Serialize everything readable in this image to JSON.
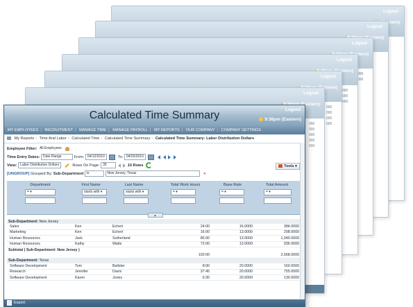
{
  "ghosts": [
    {
      "logout": "Logout",
      "time": "9:36pm (Eastern)",
      "col": []
    },
    {
      "logout": "Logout",
      "time": "9:36pm (Eastern)",
      "col": []
    },
    {
      "logout": "Logout",
      "time": "9:36pm (Eastern)",
      "col": [
        "000",
        "000"
      ]
    },
    {
      "logout": "Logout",
      "time": "9:36pm (Eastern)",
      "col": [
        "000",
        "000",
        "000"
      ]
    },
    {
      "logout": "Logout",
      "time": "9:36pm (Eastern)",
      "col": [
        "000",
        "000",
        "000",
        "000"
      ]
    },
    {
      "logout": "Logout",
      "time": "9:36pm (Eastern)",
      "col": [
        "000",
        "000",
        "000",
        "000",
        "000"
      ]
    }
  ],
  "header": {
    "title": "Calculated Time Summary",
    "logout": "Logout",
    "time": "9:36pm (Eastern)"
  },
  "nav": [
    "MY EMPLOYEES",
    "RECRUITMENT",
    "MANAGE TIME",
    "MANAGE PAYROLL",
    "MY REPORTS",
    "OUR COMPANY",
    "COMPANY SETTINGS"
  ],
  "breadcrumb": {
    "items": [
      "My Reports",
      "Time And Labor",
      "Calculated Time",
      "Calculated Time Summary"
    ],
    "current": "Calculated Time Summary: Labor Distribution Dollars"
  },
  "filters": {
    "employee_label": "Employee Filter:",
    "employee_value": "All Employees",
    "dates_label": "Time Entry Dates:",
    "dates_mode": "Date Range",
    "from_label": "From:",
    "from": "04/12/2010",
    "to_label": "To:",
    "to": "04/25/2010",
    "view_label": "View:",
    "view_value": "Labor Distribution Dollars",
    "rows_label": "Rows On Page:",
    "rows_value": "35",
    "rows_count": "10 Rows",
    "tools": "Tools",
    "ungroup": "[UNGROUP]",
    "grouped_label": "Grouped By:",
    "grouped_value": "Sub-Department",
    "op": "is",
    "group_value": "New Jersey; Texas"
  },
  "columns": [
    "Department",
    "First Name",
    "Last Name",
    "Total Work Hours",
    "Base Rate",
    "Total Amount"
  ],
  "column_filters": [
    "=",
    "starts with",
    "starts with",
    "=",
    "=",
    "="
  ],
  "groups": [
    {
      "label": "Sub-Department:",
      "name": "New Jersey",
      "rows": [
        [
          "Sales",
          "Ken",
          "Echert",
          "24:00",
          "16.0000",
          "384.0000"
        ],
        [
          "Marketing",
          "Ken",
          "Echert",
          "16:00",
          "13.0000",
          "208.0000"
        ],
        [
          "Human Resources",
          "Jack",
          "Sutherland",
          "80.00",
          "13.0000",
          "1,040.0000"
        ],
        [
          "Human Resources",
          "Kathy",
          "Watts",
          "72:00",
          "13.0000",
          "936.0000"
        ]
      ],
      "subtotal_label": "Subtotal ( Sub-Department: New Jersey )",
      "subtotal_hours": "192:00",
      "subtotal_amount": "2,568.0000"
    },
    {
      "label": "Sub-Department:",
      "name": "Texas",
      "rows": [
        [
          "Software Development",
          "Tom",
          "Ballster",
          "8:00",
          "20.0000",
          "160.0000"
        ],
        [
          "Research",
          "Jennifer",
          "Davis",
          "37:45",
          "20.0000",
          "755.0000"
        ],
        [
          "Software Development",
          "Karen",
          "Jones",
          "6:30",
          "20.0000",
          "130.0000"
        ]
      ]
    }
  ],
  "footer": {
    "export": "Export"
  }
}
